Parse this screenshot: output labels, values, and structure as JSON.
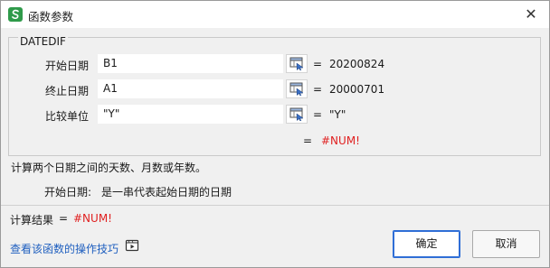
{
  "window": {
    "title": "函数参数",
    "icon": "wps-spreadsheet-icon"
  },
  "function_name": "DATEDIF",
  "arguments": [
    {
      "label": "开始日期",
      "input": "B1",
      "value": "20200824"
    },
    {
      "label": "终止日期",
      "input": "A1",
      "value": "20000701"
    },
    {
      "label": "比较单位",
      "input": "\"Y\"",
      "value": "\"Y\""
    }
  ],
  "equals_sign": "=",
  "result": "#NUM!",
  "description": "计算两个日期之间的天数、月数或年数。",
  "param_help": {
    "name": "开始日期:",
    "text": "是一串代表起始日期的日期"
  },
  "calc_result": {
    "label": "计算结果",
    "eq": "=",
    "value": "#NUM!"
  },
  "help_link": "查看该函数的操作技巧",
  "buttons": {
    "ok": "确定",
    "cancel": "取消"
  },
  "colors": {
    "error": "#e02020",
    "link": "#1f5fbf",
    "primary_border": "#2f6ed6",
    "app_icon": "#2f9a4a"
  }
}
